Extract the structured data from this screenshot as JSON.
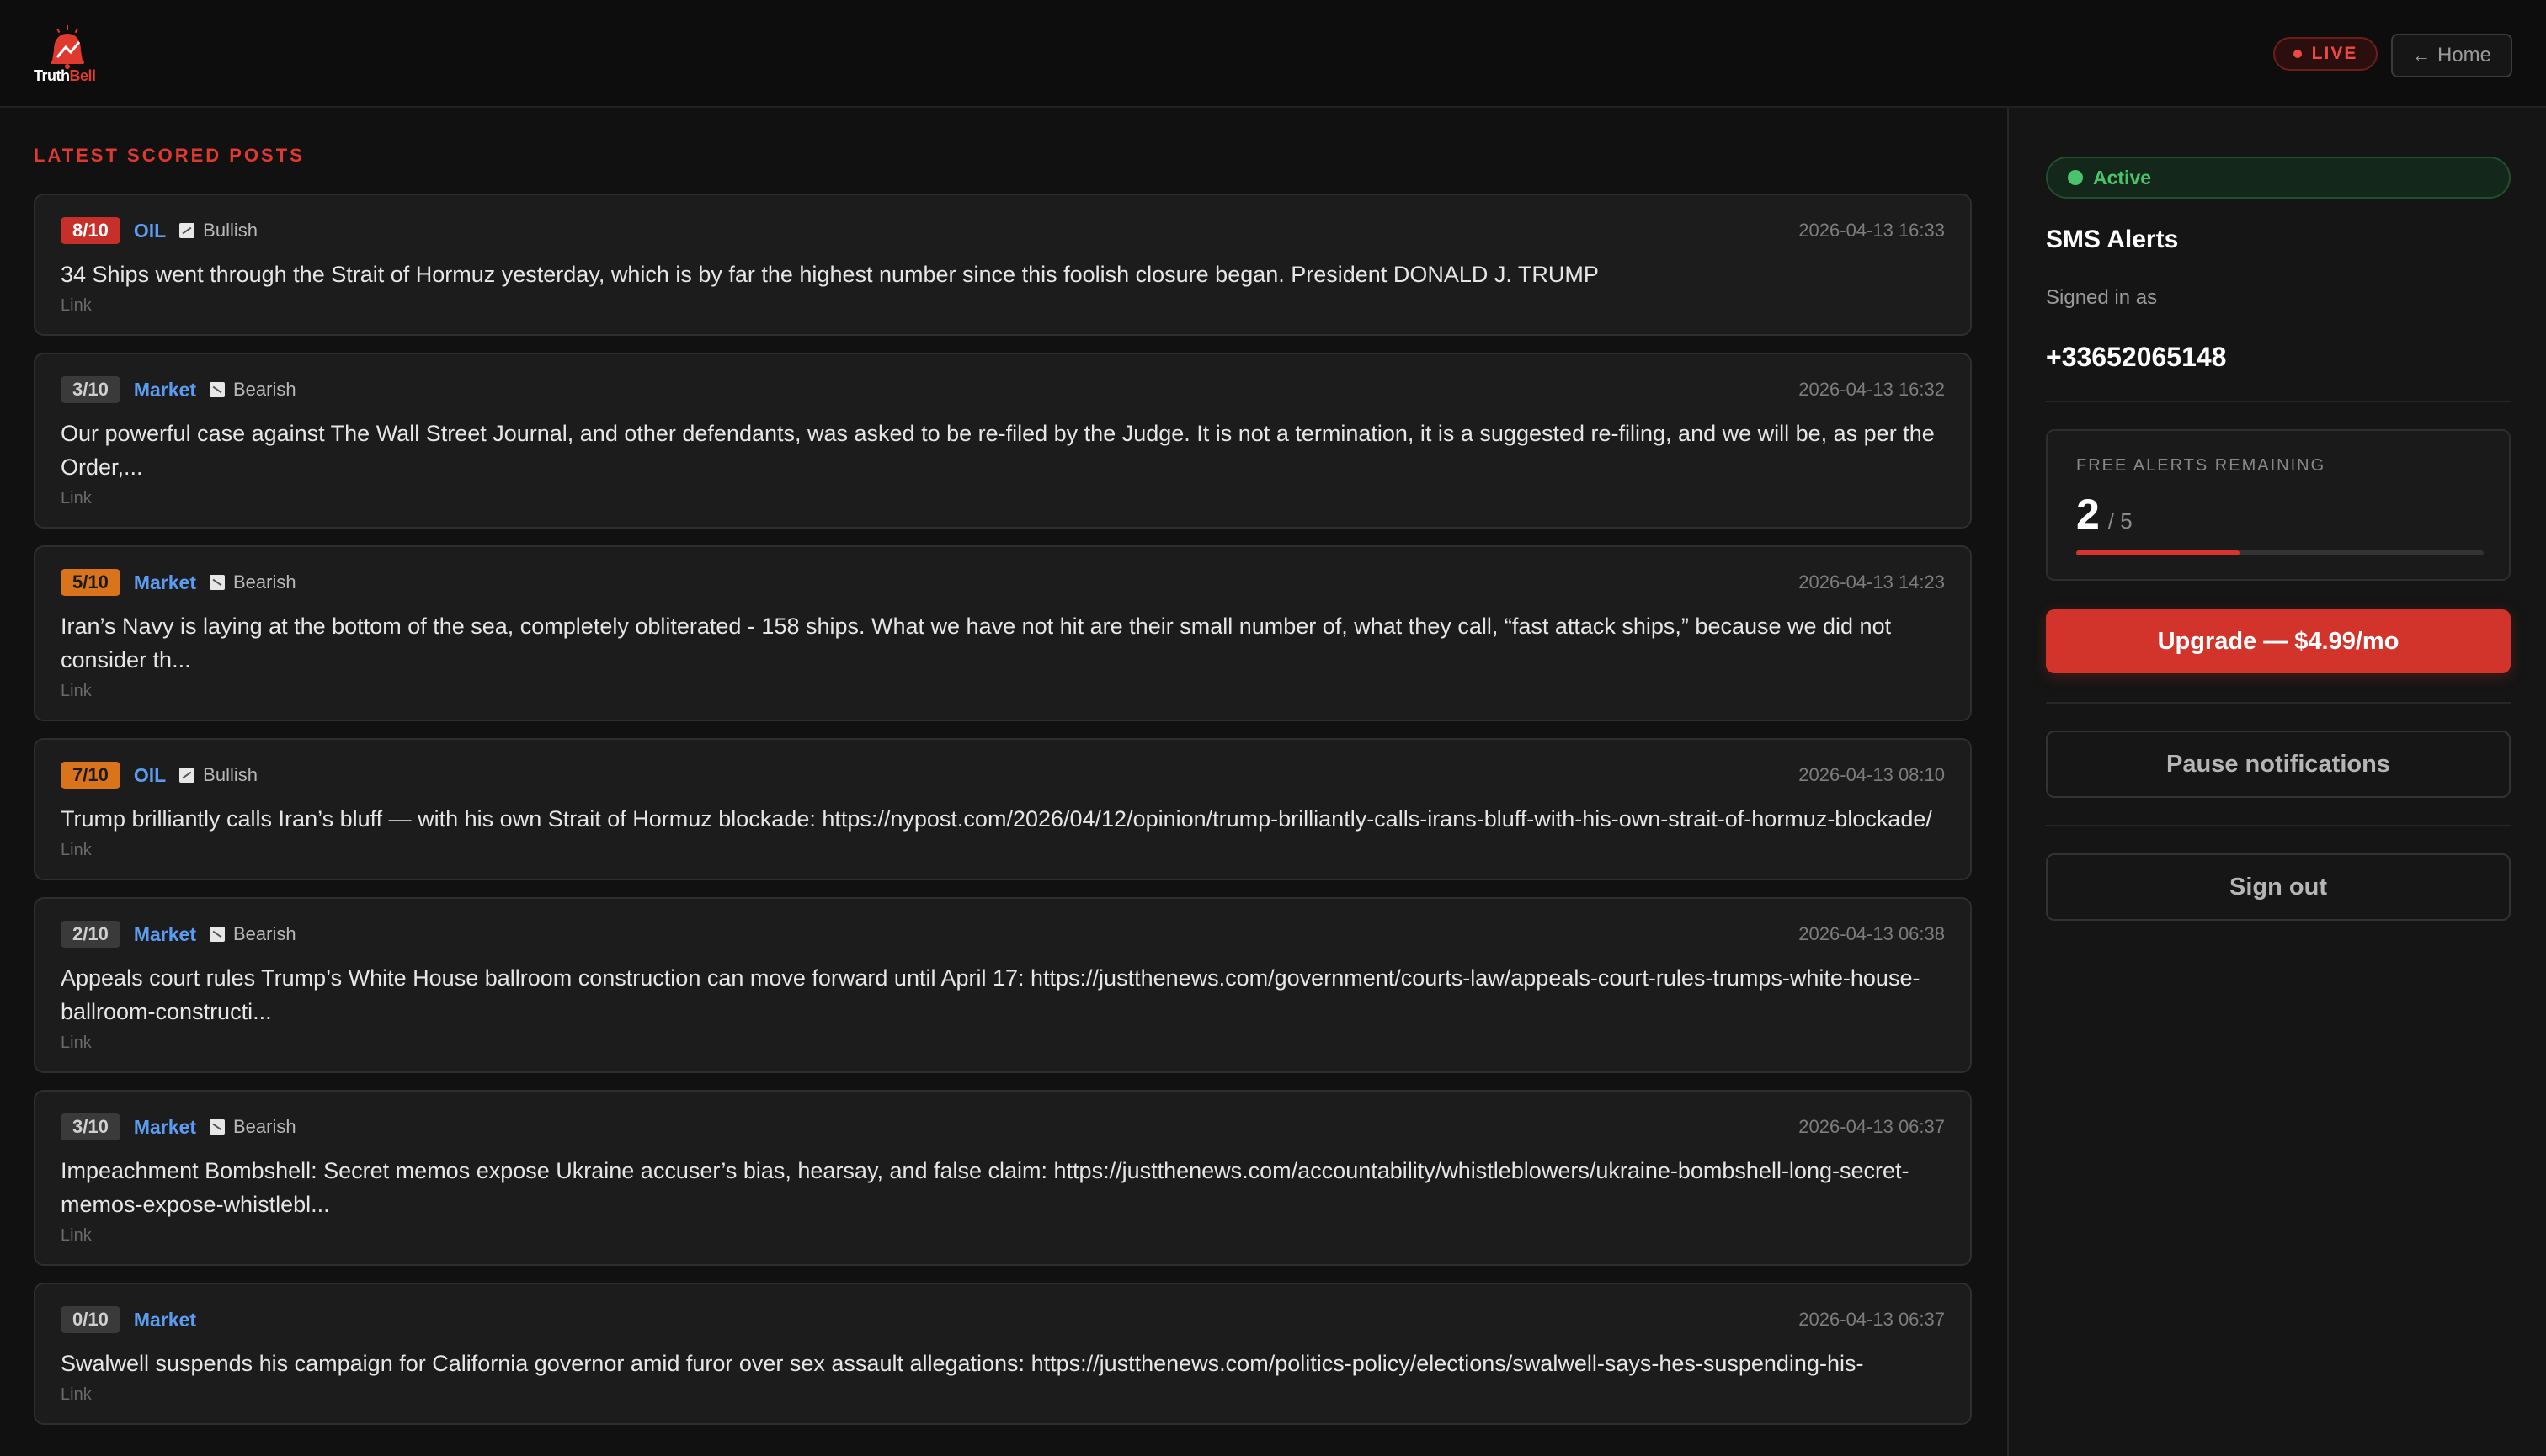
{
  "header": {
    "logo_text_primary": "Truth",
    "logo_text_accent": "Bell",
    "live_label": "LIVE",
    "home_label": "Home",
    "home_icon": "arrow-left-icon"
  },
  "main": {
    "section_title": "LATEST SCORED POSTS",
    "posts": [
      {
        "score": "8/10",
        "score_color": "#c7302a",
        "category": "OIL",
        "sentiment": "Bullish",
        "timestamp": "2026-04-13 16:33",
        "text": "34 Ships went through the Strait of Hormuz yesterday, which is by far the highest number since this foolish closure began. President DONALD J. TRUMP",
        "link": "Link"
      },
      {
        "score": "3/10",
        "score_color": "#3a3a3a",
        "category": "Market",
        "sentiment": "Bearish",
        "timestamp": "2026-04-13 16:32",
        "text": "Our powerful case against The Wall Street Journal, and other defendants, was asked to be re-filed by the Judge. It is not a termination, it is a suggested re-filing, and we will be, as per the Order,...",
        "link": "Link"
      },
      {
        "score": "5/10",
        "score_color": "#d9731c",
        "category": "Market",
        "sentiment": "Bearish",
        "timestamp": "2026-04-13 14:23",
        "text": "Iran’s Navy is laying at the bottom of the sea, completely obliterated - 158 ships. What we have not hit are their small number of, what they call, “fast attack ships,” because we did not consider th...",
        "link": "Link"
      },
      {
        "score": "7/10",
        "score_color": "#d9731c",
        "category": "OIL",
        "sentiment": "Bullish",
        "timestamp": "2026-04-13 08:10",
        "text": "Trump brilliantly calls Iran’s bluff — with his own Strait of Hormuz blockade: https://nypost.com/2026/04/12/opinion/trump-brilliantly-calls-irans-bluff-with-his-own-strait-of-hormuz-blockade/",
        "link": "Link"
      },
      {
        "score": "2/10",
        "score_color": "#3a3a3a",
        "category": "Market",
        "sentiment": "Bearish",
        "timestamp": "2026-04-13 06:38",
        "text": "Appeals court rules Trump’s White House ballroom construction can move forward until April 17: https://justthenews.com/government/courts-law/appeals-court-rules-trumps-white-house-ballroom-constructi...",
        "link": "Link"
      },
      {
        "score": "3/10",
        "score_color": "#3a3a3a",
        "category": "Market",
        "sentiment": "Bearish",
        "timestamp": "2026-04-13 06:37",
        "text": "Impeachment Bombshell: Secret memos expose Ukraine accuser’s bias, hearsay, and false claim: https://justthenews.com/accountability/whistleblowers/ukraine-bombshell-long-secret-memos-expose-whistlebl...",
        "link": "Link"
      },
      {
        "score": "0/10",
        "score_color": "#3a3a3a",
        "category": "Market",
        "sentiment": "",
        "timestamp": "2026-04-13 06:37",
        "text": "Swalwell suspends his campaign for California governor amid furor over sex assault allegations: https://justthenews.com/politics-policy/elections/swalwell-says-hes-suspending-his-",
        "link": "Link"
      }
    ]
  },
  "sidebar": {
    "status_label": "Active",
    "status_color": "#49c46c",
    "title": "SMS Alerts",
    "signed_in_label": "Signed in as",
    "phone": "+33652065148",
    "alerts": {
      "label": "FREE ALERTS REMAINING",
      "remaining": "2",
      "total_label": "/ 5",
      "progress_fraction": 0.4
    },
    "upgrade_label": "Upgrade — $4.99/mo",
    "pause_label": "Pause notifications",
    "signout_label": "Sign out"
  }
}
